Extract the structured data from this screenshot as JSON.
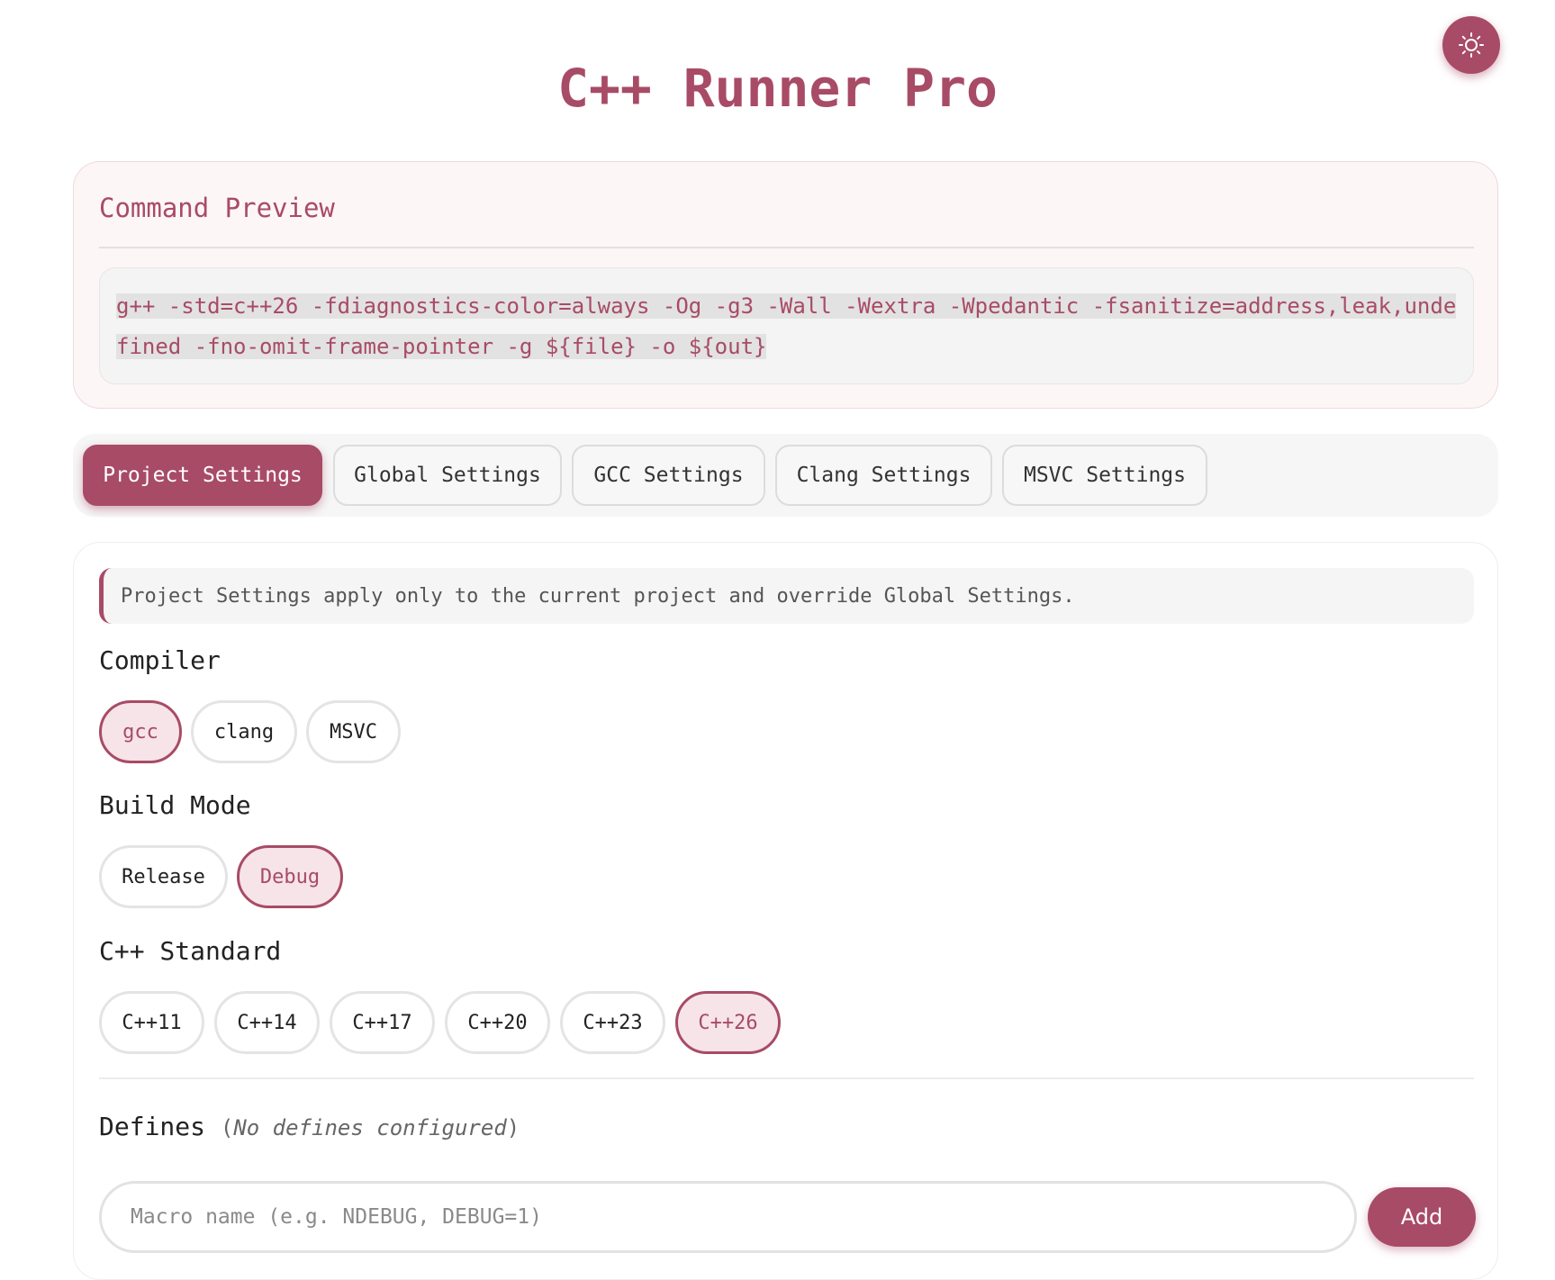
{
  "app": {
    "title": "C++ Runner Pro",
    "theme_toggle_icon": "sun-icon"
  },
  "colors": {
    "accent": "#a84b66",
    "selected_bg": "#f6e4e8"
  },
  "preview": {
    "heading": "Command Preview",
    "command": "g++ -std=c++26 -fdiagnostics-color=always -Og -g3 -Wall -Wextra -Wpedantic -fsanitize=address,leak,undefined -fno-omit-frame-pointer -g ${file} -o ${out}"
  },
  "tabs": [
    {
      "label": "Project Settings",
      "active": true
    },
    {
      "label": "Global Settings",
      "active": false
    },
    {
      "label": "GCC Settings",
      "active": false
    },
    {
      "label": "Clang Settings",
      "active": false
    },
    {
      "label": "MSVC Settings",
      "active": false
    }
  ],
  "settings": {
    "info": "Project Settings apply only to the current project and override Global Settings.",
    "compiler": {
      "label": "Compiler",
      "options": [
        "gcc",
        "clang",
        "MSVC"
      ],
      "selected": "gcc"
    },
    "build_mode": {
      "label": "Build Mode",
      "options": [
        "Release",
        "Debug"
      ],
      "selected": "Debug"
    },
    "standard": {
      "label": "C++ Standard",
      "options": [
        "C++11",
        "C++14",
        "C++17",
        "C++20",
        "C++23",
        "C++26"
      ],
      "selected": "C++26"
    },
    "defines": {
      "label": "Defines",
      "note_open": "(",
      "note": "No defines configured",
      "note_close": ")",
      "input_value": "",
      "input_placeholder": "Macro name (e.g. NDEBUG, DEBUG=1)",
      "add_label": "Add"
    }
  }
}
